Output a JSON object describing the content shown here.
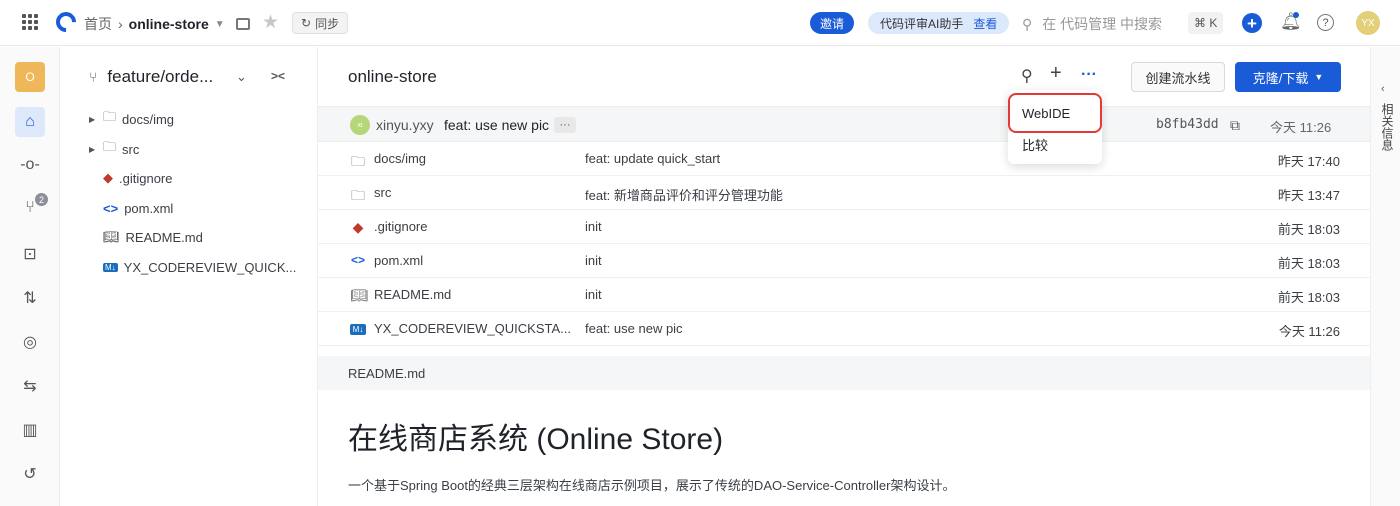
{
  "topbar": {
    "home": "首页",
    "repo": "online-store",
    "sync": "同步",
    "invite": "邀请",
    "ai_label": "代码评审AI助手",
    "ai_action": "查看",
    "search_placeholder": "在 代码管理 中搜索",
    "shortcut": "⌘ K",
    "avatar": "YX"
  },
  "rail": {
    "project_initial": "O",
    "merge_badge": "2",
    "icons": [
      "project-icon",
      "code-icon",
      "commit-icon",
      "branch-icon",
      "tag-icon",
      "merge-request-icon",
      "review-icon",
      "pipeline-icon",
      "stats-icon",
      "history-icon"
    ]
  },
  "tree": {
    "branch": "feature/orde...",
    "items": [
      {
        "label": "docs/img",
        "icon": "folder-icon"
      },
      {
        "label": "src",
        "icon": "folder-icon"
      },
      {
        "label": ".gitignore",
        "icon": "git-icon"
      },
      {
        "label": "pom.xml",
        "icon": "xml-icon"
      },
      {
        "label": "README.md",
        "icon": "book-icon"
      },
      {
        "label": "YX_CODEREVIEW_QUICK...",
        "icon": "markdown-icon"
      }
    ]
  },
  "main": {
    "title": "online-store",
    "pipeline_button": "创建流水线",
    "clone_button": "克隆/下载",
    "commit": {
      "avatar": "xi",
      "author": "xinyu.yxy",
      "message": "feat: use new pic",
      "more": "···",
      "hash": "b8fb43dd",
      "time": "今天 11:26"
    },
    "files": [
      {
        "name": "docs/img",
        "message": "feat: update quick_start",
        "time": "昨天 17:40"
      },
      {
        "name": "src",
        "message": "feat: 新增商品评价和评分管理功能",
        "time": "昨天 13:47"
      },
      {
        "name": ".gitignore",
        "message": "init",
        "time": "前天 18:03"
      },
      {
        "name": "pom.xml",
        "message": "init",
        "time": "前天 18:03"
      },
      {
        "name": "README.md",
        "message": "init",
        "time": "前天 18:03"
      },
      {
        "name": "YX_CODEREVIEW_QUICKSTA...",
        "message": "feat: use new pic",
        "time": "今天 11:26"
      }
    ],
    "readme_header": "README.md",
    "readme_title": "在线商店系统 (Online Store)",
    "readme_text": "一个基于Spring Boot的经典三层架构在线商店示例项目，展示了传统的DAO-Service-Controller架构设计。"
  },
  "dropdown": {
    "webide": "WebIDE",
    "compare": "比较"
  },
  "right_panel": {
    "label": "相关信息"
  },
  "colors": {
    "accent": "#1a5cd8",
    "highlight": "#e53935"
  }
}
